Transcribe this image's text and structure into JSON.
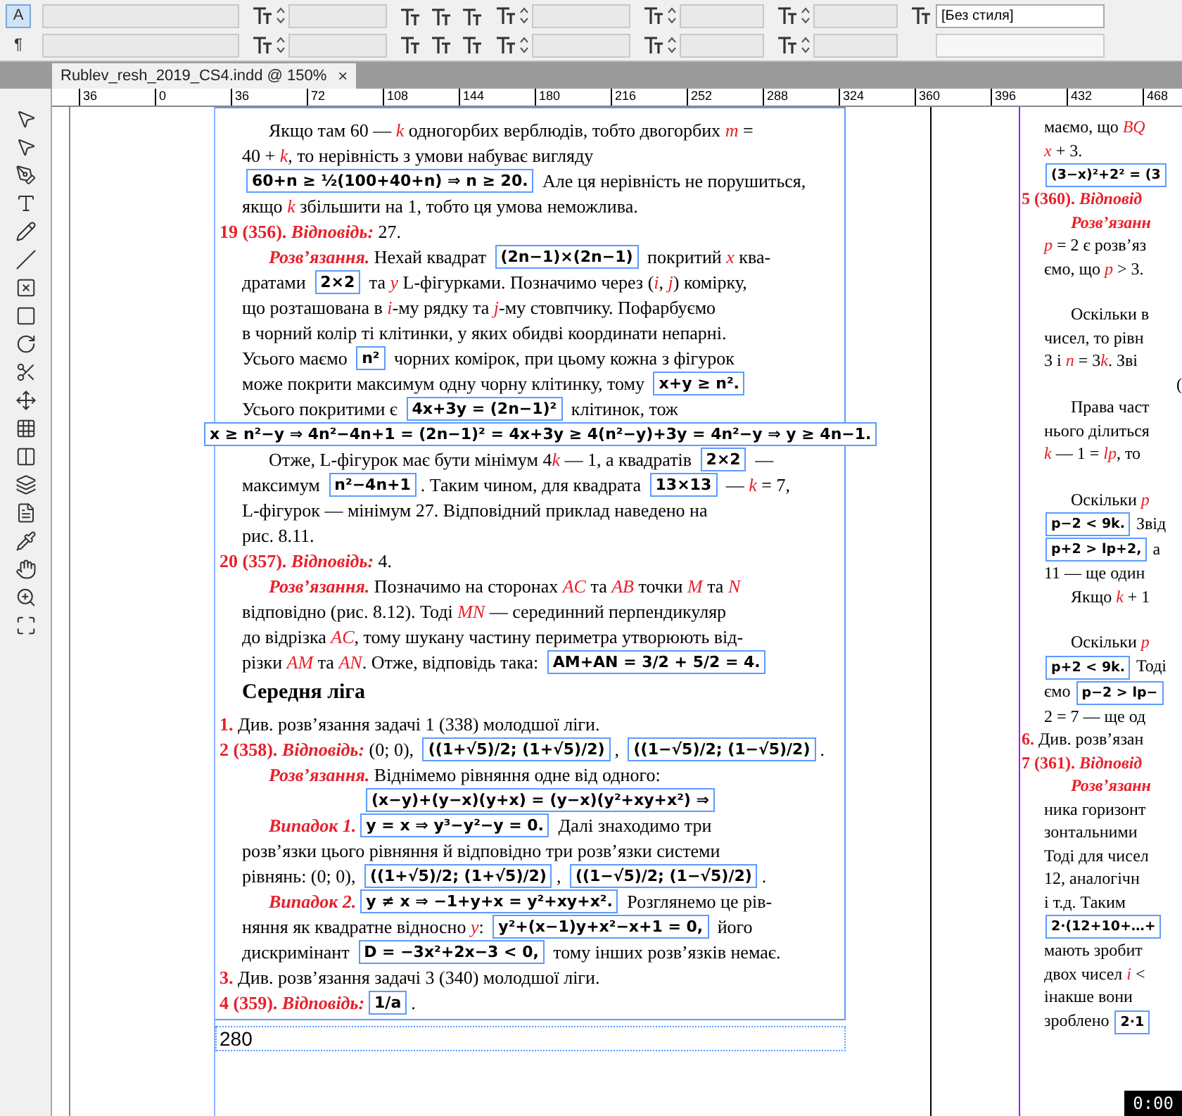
{
  "toolbar": {
    "mode_buttons": [
      {
        "label": "A",
        "selected": true
      },
      {
        "label": "¶",
        "selected": false
      }
    ],
    "style_field": "[Без стиля]"
  },
  "tab": {
    "title": "Rublev_resh_2019_CS4.indd @ 150%",
    "close": "×"
  },
  "ruler": [
    "36",
    "0",
    "36",
    "72",
    "108",
    "144",
    "180",
    "216",
    "252",
    "288",
    "324",
    "360",
    "396",
    "432",
    "468"
  ],
  "left_page": {
    "page_number": "280",
    "lines": [
      {
        "kind": "indent",
        "segs": [
          {
            "kind": "text",
            "text": "Якщо там 60 — "
          },
          {
            "kind": "var",
            "text": "k"
          },
          {
            "kind": "text",
            "text": " одногорбих верблюдів, тобто двогорбих "
          },
          {
            "kind": "var",
            "text": "m"
          },
          {
            "kind": "text",
            "text": " ="
          }
        ]
      },
      {
        "kind": "plain",
        "segs": [
          {
            "kind": "text",
            "text": "40 + "
          },
          {
            "kind": "var",
            "text": "k"
          },
          {
            "kind": "text",
            "text": ", то нерівність з умови набуває вигляду"
          }
        ]
      },
      {
        "kind": "plain",
        "segs": [
          {
            "kind": "formula",
            "text": "60+n ≥ ½(100+40+n) ⇒ n ≥ 20."
          },
          {
            "kind": "text",
            "text": " Але ця нерівність не порушиться,"
          }
        ]
      },
      {
        "kind": "plain",
        "segs": [
          {
            "kind": "text",
            "text": "якщо "
          },
          {
            "kind": "var",
            "text": "k"
          },
          {
            "kind": "text",
            "text": " збільшити на 1, тобто ця умова неможлива."
          }
        ]
      },
      {
        "kind": "outdent",
        "segs": [
          {
            "kind": "label",
            "text": "19 (356). "
          },
          {
            "kind": "label_italic",
            "text": "Відповідь:"
          },
          {
            "kind": "text",
            "text": " 27."
          }
        ]
      },
      {
        "kind": "indent",
        "segs": [
          {
            "kind": "label_italic",
            "text": "Розв’язання."
          },
          {
            "kind": "text",
            "text": " Нехай квадрат "
          },
          {
            "kind": "formula",
            "text": "(2n−1)×(2n−1)"
          },
          {
            "kind": "text",
            "text": " покритий "
          },
          {
            "kind": "var",
            "text": "x"
          },
          {
            "kind": "text",
            "text": " ква-"
          }
        ]
      },
      {
        "kind": "plain",
        "segs": [
          {
            "kind": "text",
            "text": "дратами "
          },
          {
            "kind": "formula",
            "text": "2×2"
          },
          {
            "kind": "text",
            "text": " та "
          },
          {
            "kind": "var",
            "text": "y"
          },
          {
            "kind": "text",
            "text": " L-фігурками. Позначимо через ("
          },
          {
            "kind": "var",
            "text": "i"
          },
          {
            "kind": "text",
            "text": ", "
          },
          {
            "kind": "var",
            "text": "j"
          },
          {
            "kind": "text",
            "text": ") комірку,"
          }
        ]
      },
      {
        "kind": "plain",
        "segs": [
          {
            "kind": "text",
            "text": "що розташована в "
          },
          {
            "kind": "var",
            "text": "i"
          },
          {
            "kind": "text",
            "text": "-му рядку та "
          },
          {
            "kind": "var",
            "text": "j"
          },
          {
            "kind": "text",
            "text": "-му стовпчику. Пофарбуємо"
          }
        ]
      },
      {
        "kind": "plain",
        "segs": [
          {
            "kind": "text",
            "text": "в чорний колір ті клітинки, у яких обидві координати непарні."
          }
        ]
      },
      {
        "kind": "plain",
        "segs": [
          {
            "kind": "text",
            "text": "Усього маємо "
          },
          {
            "kind": "formula",
            "text": "n²"
          },
          {
            "kind": "text",
            "text": " чорних комірок, при цьому кожна з фігурок"
          }
        ]
      },
      {
        "kind": "plain",
        "segs": [
          {
            "kind": "text",
            "text": "може покрити максимум одну чорну клітинку, тому "
          },
          {
            "kind": "formula",
            "text": "x+y ≥ n²."
          }
        ]
      },
      {
        "kind": "plain",
        "segs": [
          {
            "kind": "text",
            "text": "Усього покритими є "
          },
          {
            "kind": "formula",
            "text": "4x+3y = (2n−1)²"
          },
          {
            "kind": "text",
            "text": " клітинок, тож"
          }
        ]
      },
      {
        "kind": "wide",
        "segs": [
          {
            "kind": "formula",
            "text": "x ≥ n²−y ⇒ 4n²−4n+1 = (2n−1)² = 4x+3y ≥ 4(n²−y)+3y = 4n²−y ⇒ y ≥ 4n−1."
          }
        ]
      },
      {
        "kind": "indent",
        "segs": [
          {
            "kind": "text",
            "text": "Отже, L-фігурок має бути мінімум 4"
          },
          {
            "kind": "var",
            "text": "k"
          },
          {
            "kind": "text",
            "text": " — 1, а квадратів "
          },
          {
            "kind": "formula",
            "text": "2×2"
          },
          {
            "kind": "text",
            "text": " —"
          }
        ]
      },
      {
        "kind": "plain",
        "segs": [
          {
            "kind": "text",
            "text": "максимум "
          },
          {
            "kind": "formula",
            "text": "n²−4n+1"
          },
          {
            "kind": "text",
            "text": ". Таким чином, для квадрата "
          },
          {
            "kind": "formula",
            "text": "13×13"
          },
          {
            "kind": "text",
            "text": " — "
          },
          {
            "kind": "var",
            "text": "k"
          },
          {
            "kind": "text",
            "text": " = 7,"
          }
        ]
      },
      {
        "kind": "plain",
        "segs": [
          {
            "kind": "text",
            "text": "L-фігурок — мінімум 27. Відповідний приклад наведено на"
          }
        ]
      },
      {
        "kind": "plain",
        "segs": [
          {
            "kind": "text",
            "text": "рис. 8.11."
          }
        ]
      },
      {
        "kind": "outdent",
        "segs": [
          {
            "kind": "label",
            "text": "20 (357). "
          },
          {
            "kind": "label_italic",
            "text": "Відповідь:"
          },
          {
            "kind": "text",
            "text": " 4."
          }
        ]
      },
      {
        "kind": "indent",
        "segs": [
          {
            "kind": "label_italic",
            "text": "Розв’язання."
          },
          {
            "kind": "text",
            "text": " Позначимо на сторонах "
          },
          {
            "kind": "var",
            "text": "AC"
          },
          {
            "kind": "text",
            "text": " та "
          },
          {
            "kind": "var",
            "text": "AB"
          },
          {
            "kind": "text",
            "text": " точки "
          },
          {
            "kind": "var",
            "text": "M"
          },
          {
            "kind": "text",
            "text": " та "
          },
          {
            "kind": "var",
            "text": "N"
          }
        ]
      },
      {
        "kind": "plain",
        "segs": [
          {
            "kind": "text",
            "text": "відповідно (рис. 8.12). Тоді "
          },
          {
            "kind": "var",
            "text": "MN"
          },
          {
            "kind": "text",
            "text": " — серединний перпендикуляр"
          }
        ]
      },
      {
        "kind": "plain",
        "segs": [
          {
            "kind": "text",
            "text": "до відрізка "
          },
          {
            "kind": "var",
            "text": "AC"
          },
          {
            "kind": "text",
            "text": ", тому шукану частину периметра утворюють від-"
          }
        ]
      },
      {
        "kind": "plain",
        "segs": [
          {
            "kind": "text",
            "text": "різки "
          },
          {
            "kind": "var",
            "text": "AM"
          },
          {
            "kind": "text",
            "text": " та "
          },
          {
            "kind": "var",
            "text": "AN"
          },
          {
            "kind": "text",
            "text": ". Отже, відповідь така: "
          },
          {
            "kind": "formula",
            "text": "AM+AN = 3/2 + 5/2 = 4."
          }
        ]
      },
      {
        "kind": "heading",
        "segs": [
          {
            "kind": "bold",
            "text": "Середня ліга"
          }
        ]
      },
      {
        "kind": "outdent",
        "segs": [
          {
            "kind": "label",
            "text": "1."
          },
          {
            "kind": "text",
            "text": " Див. розв’язання задачі 1 (338) молодшої ліги."
          }
        ]
      },
      {
        "kind": "outdent",
        "segs": [
          {
            "kind": "label",
            "text": "2 (358). "
          },
          {
            "kind": "label_italic",
            "text": "Відповідь:"
          },
          {
            "kind": "text",
            "text": " (0; 0), "
          },
          {
            "kind": "formula",
            "text": "((1+√5)/2; (1+√5)/2)"
          },
          {
            "kind": "text",
            "text": ", "
          },
          {
            "kind": "formula",
            "text": "((1−√5)/2; (1−√5)/2)"
          },
          {
            "kind": "text",
            "text": "."
          }
        ]
      },
      {
        "kind": "indent",
        "segs": [
          {
            "kind": "label_italic",
            "text": "Розв’язання."
          },
          {
            "kind": "text",
            "text": " Віднімемо рівняння одне від одного:"
          }
        ]
      },
      {
        "kind": "center",
        "segs": [
          {
            "kind": "formula",
            "text": "(x−y)+(y−x)(y+x) = (y−x)(y²+xy+x²) ⇒"
          }
        ]
      },
      {
        "kind": "indent",
        "segs": [
          {
            "kind": "label_italic",
            "text": "Випадок 1."
          },
          {
            "kind": "formula",
            "text": "y = x ⇒ y³−y²−y = 0."
          },
          {
            "kind": "text",
            "text": " Далі знаходимо три"
          }
        ]
      },
      {
        "kind": "plain",
        "segs": [
          {
            "kind": "text",
            "text": "розв’язки цього рівняння й відповідно три розв’язки системи"
          }
        ]
      },
      {
        "kind": "plain",
        "segs": [
          {
            "kind": "text",
            "text": "рівнянь: (0; 0), "
          },
          {
            "kind": "formula",
            "text": "((1+√5)/2; (1+√5)/2)"
          },
          {
            "kind": "text",
            "text": ", "
          },
          {
            "kind": "formula",
            "text": "((1−√5)/2; (1−√5)/2)"
          },
          {
            "kind": "text",
            "text": "."
          }
        ]
      },
      {
        "kind": "indent",
        "segs": [
          {
            "kind": "label_italic",
            "text": "Випадок 2."
          },
          {
            "kind": "formula",
            "text": "y ≠ x ⇒ −1+y+x = y²+xy+x²."
          },
          {
            "kind": "text",
            "text": " Розглянемо це рів-"
          }
        ]
      },
      {
        "kind": "plain",
        "segs": [
          {
            "kind": "text",
            "text": "няння як квадратне відносно "
          },
          {
            "kind": "var",
            "text": "y"
          },
          {
            "kind": "text",
            "text": ": "
          },
          {
            "kind": "formula",
            "text": "y²+(x−1)y+x²−x+1 = 0,"
          },
          {
            "kind": "text",
            "text": " його"
          }
        ]
      },
      {
        "kind": "plain",
        "segs": [
          {
            "kind": "text",
            "text": "дискримінант "
          },
          {
            "kind": "formula",
            "text": "D = −3x²+2x−3 < 0,"
          },
          {
            "kind": "text",
            "text": " тому інших розв’язків немає."
          }
        ]
      },
      {
        "kind": "outdent",
        "segs": [
          {
            "kind": "label",
            "text": "3."
          },
          {
            "kind": "text",
            "text": " Див. розв’язання задачі 3 (340) молодшої ліги."
          }
        ]
      },
      {
        "kind": "outdent",
        "segs": [
          {
            "kind": "label",
            "text": "4 (359). "
          },
          {
            "kind": "label_italic",
            "text": "Відповідь:"
          },
          {
            "kind": "formula",
            "text": "1/a"
          },
          {
            "kind": "text",
            "text": "."
          }
        ]
      }
    ]
  },
  "right_page": {
    "lines": [
      {
        "kind": "plain",
        "segs": [
          {
            "kind": "text",
            "text": "маємо, що "
          },
          {
            "kind": "var",
            "text": "BQ"
          }
        ]
      },
      {
        "kind": "plain",
        "segs": [
          {
            "kind": "var",
            "text": "x"
          },
          {
            "kind": "text",
            "text": " + 3."
          }
        ]
      },
      {
        "kind": "plain",
        "segs": [
          {
            "kind": "formula",
            "text": "(3−x)²+2² = (3"
          }
        ]
      },
      {
        "kind": "outdent",
        "segs": [
          {
            "kind": "label",
            "text": "5 (360). "
          },
          {
            "kind": "label_italic",
            "text": "Відповід"
          }
        ]
      },
      {
        "kind": "indent",
        "segs": [
          {
            "kind": "label_italic",
            "text": "Розв’язанн"
          }
        ]
      },
      {
        "kind": "plain",
        "segs": [
          {
            "kind": "var",
            "text": "p"
          },
          {
            "kind": "text",
            "text": " = 2 є розв’яз"
          }
        ]
      },
      {
        "kind": "plain",
        "segs": [
          {
            "kind": "text",
            "text": "ємо, що "
          },
          {
            "kind": "var",
            "text": "p"
          },
          {
            "kind": "text",
            "text": " > 3."
          }
        ]
      },
      {
        "kind": "blank"
      },
      {
        "kind": "indent",
        "segs": [
          {
            "kind": "text",
            "text": "Оскільки в"
          }
        ]
      },
      {
        "kind": "plain",
        "segs": [
          {
            "kind": "text",
            "text": "чисел, то рівн"
          }
        ]
      },
      {
        "kind": "plain",
        "segs": [
          {
            "kind": "text",
            "text": "3 і "
          },
          {
            "kind": "var",
            "text": "n"
          },
          {
            "kind": "text",
            "text": " = 3"
          },
          {
            "kind": "var",
            "text": "k"
          },
          {
            "kind": "text",
            "text": ". Зві"
          }
        ]
      },
      {
        "kind": "right",
        "segs": [
          {
            "kind": "text",
            "text": "("
          }
        ]
      },
      {
        "kind": "indent",
        "segs": [
          {
            "kind": "text",
            "text": "Права част"
          }
        ]
      },
      {
        "kind": "plain",
        "segs": [
          {
            "kind": "text",
            "text": "нього ділиться"
          }
        ]
      },
      {
        "kind": "plain",
        "segs": [
          {
            "kind": "var",
            "text": "k"
          },
          {
            "kind": "text",
            "text": " — 1 = "
          },
          {
            "kind": "var",
            "text": "lp"
          },
          {
            "kind": "text",
            "text": ", то"
          }
        ]
      },
      {
        "kind": "blank"
      },
      {
        "kind": "indent",
        "segs": [
          {
            "kind": "text",
            "text": "Оскільки "
          },
          {
            "kind": "var",
            "text": "p"
          }
        ]
      },
      {
        "kind": "plain",
        "segs": [
          {
            "kind": "formula",
            "text": "p−2 < 9k."
          },
          {
            "kind": "text",
            "text": " Звід"
          }
        ]
      },
      {
        "kind": "plain",
        "segs": [
          {
            "kind": "formula",
            "text": "p+2 > lp+2,"
          },
          {
            "kind": "text",
            "text": " а"
          }
        ]
      },
      {
        "kind": "plain",
        "segs": [
          {
            "kind": "text",
            "text": "11 — ще один"
          }
        ]
      },
      {
        "kind": "indent",
        "segs": [
          {
            "kind": "text",
            "text": "Якщо "
          },
          {
            "kind": "var",
            "text": "k"
          },
          {
            "kind": "text",
            "text": " + 1"
          }
        ]
      },
      {
        "kind": "blank"
      },
      {
        "kind": "indent",
        "segs": [
          {
            "kind": "text",
            "text": "Оскільки "
          },
          {
            "kind": "var",
            "text": "p"
          }
        ]
      },
      {
        "kind": "plain",
        "segs": [
          {
            "kind": "formula",
            "text": "p+2 < 9k."
          },
          {
            "kind": "text",
            "text": " Тоді"
          }
        ]
      },
      {
        "kind": "plain",
        "segs": [
          {
            "kind": "text",
            "text": "ємо "
          },
          {
            "kind": "formula",
            "text": "p−2 > lp−"
          }
        ]
      },
      {
        "kind": "plain",
        "segs": [
          {
            "kind": "text",
            "text": "2 = 7 — ще од"
          }
        ]
      },
      {
        "kind": "outdent",
        "segs": [
          {
            "kind": "label",
            "text": "6."
          },
          {
            "kind": "text",
            "text": " Див. розв’язан"
          }
        ]
      },
      {
        "kind": "outdent",
        "segs": [
          {
            "kind": "label",
            "text": "7 (361). "
          },
          {
            "kind": "label_italic",
            "text": "Відповід"
          }
        ]
      },
      {
        "kind": "indent",
        "segs": [
          {
            "kind": "label_italic",
            "text": "Розв’язанн"
          }
        ]
      },
      {
        "kind": "plain",
        "segs": [
          {
            "kind": "text",
            "text": "ника горизонт"
          }
        ]
      },
      {
        "kind": "plain",
        "segs": [
          {
            "kind": "text",
            "text": "зонтальними"
          }
        ]
      },
      {
        "kind": "plain",
        "segs": [
          {
            "kind": "text",
            "text": "Тоді для чисел"
          }
        ]
      },
      {
        "kind": "plain",
        "segs": [
          {
            "kind": "text",
            "text": "12, аналогічн"
          }
        ]
      },
      {
        "kind": "plain",
        "segs": [
          {
            "kind": "text",
            "text": "і т.д. Таким"
          }
        ]
      },
      {
        "kind": "plain",
        "segs": [
          {
            "kind": "formula",
            "text": "2·(12+10+…+"
          }
        ]
      },
      {
        "kind": "plain",
        "segs": [
          {
            "kind": "text",
            "text": "мають зробит"
          }
        ]
      },
      {
        "kind": "plain",
        "segs": [
          {
            "kind": "text",
            "text": "двох чисел "
          },
          {
            "kind": "var",
            "text": "i"
          },
          {
            "kind": "text",
            "text": " <"
          }
        ]
      },
      {
        "kind": "plain",
        "segs": [
          {
            "kind": "text",
            "text": "інакше вони"
          }
        ]
      },
      {
        "kind": "plain",
        "segs": [
          {
            "kind": "text",
            "text": "зроблено "
          },
          {
            "kind": "formula",
            "text": "2·1"
          }
        ]
      }
    ]
  },
  "timer": "0:00"
}
